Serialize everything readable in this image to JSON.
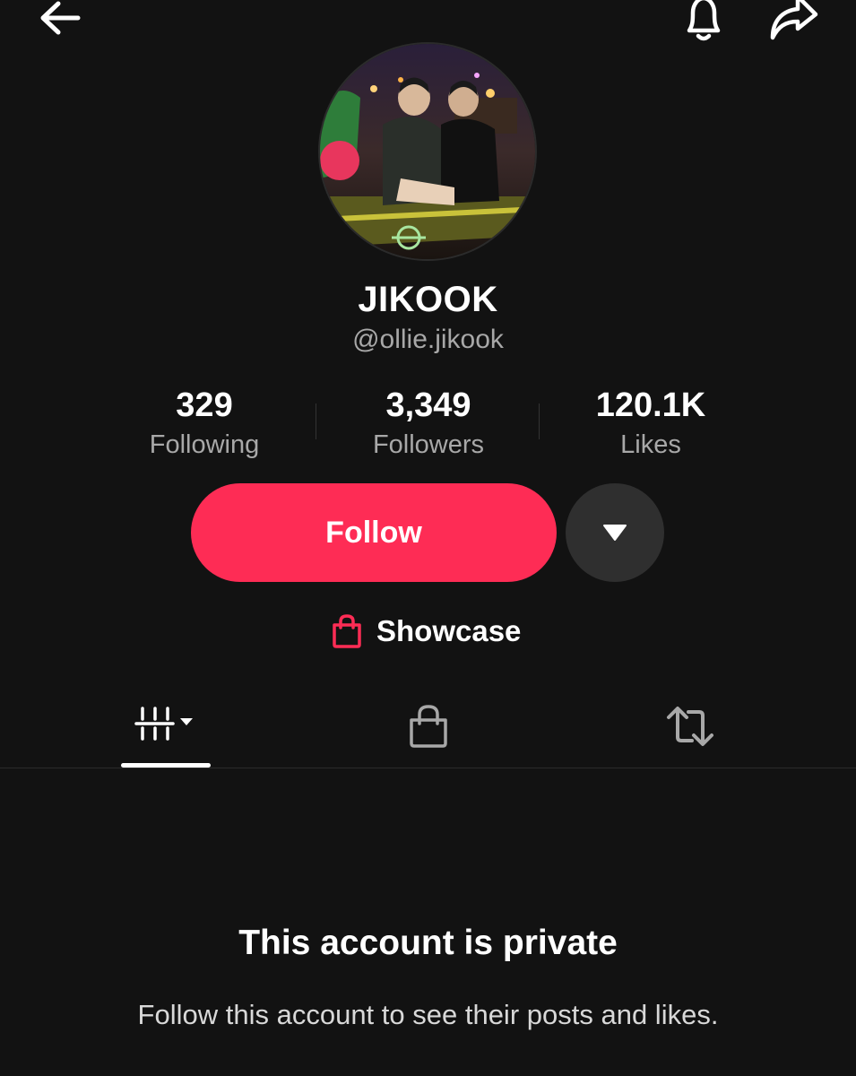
{
  "profile": {
    "display_name": "JIKOOK",
    "handle": "@ollie.jikook"
  },
  "stats": [
    {
      "value": "329",
      "label": "Following"
    },
    {
      "value": "3,349",
      "label": "Followers"
    },
    {
      "value": "120.1K",
      "label": "Likes"
    }
  ],
  "actions": {
    "follow_label": "Follow",
    "showcase_label": "Showcase"
  },
  "tabs": [
    {
      "icon": "videos-grid-icon",
      "selected": true
    },
    {
      "icon": "shopping-bag-icon",
      "selected": false
    },
    {
      "icon": "repost-icon",
      "selected": false
    }
  ],
  "private_notice": {
    "title": "This account is private",
    "description": "Follow this account to see their posts and likes."
  },
  "colors": {
    "background": "#121212",
    "accent": "#fe2c55",
    "secondary_text": "#a8a8a8"
  }
}
